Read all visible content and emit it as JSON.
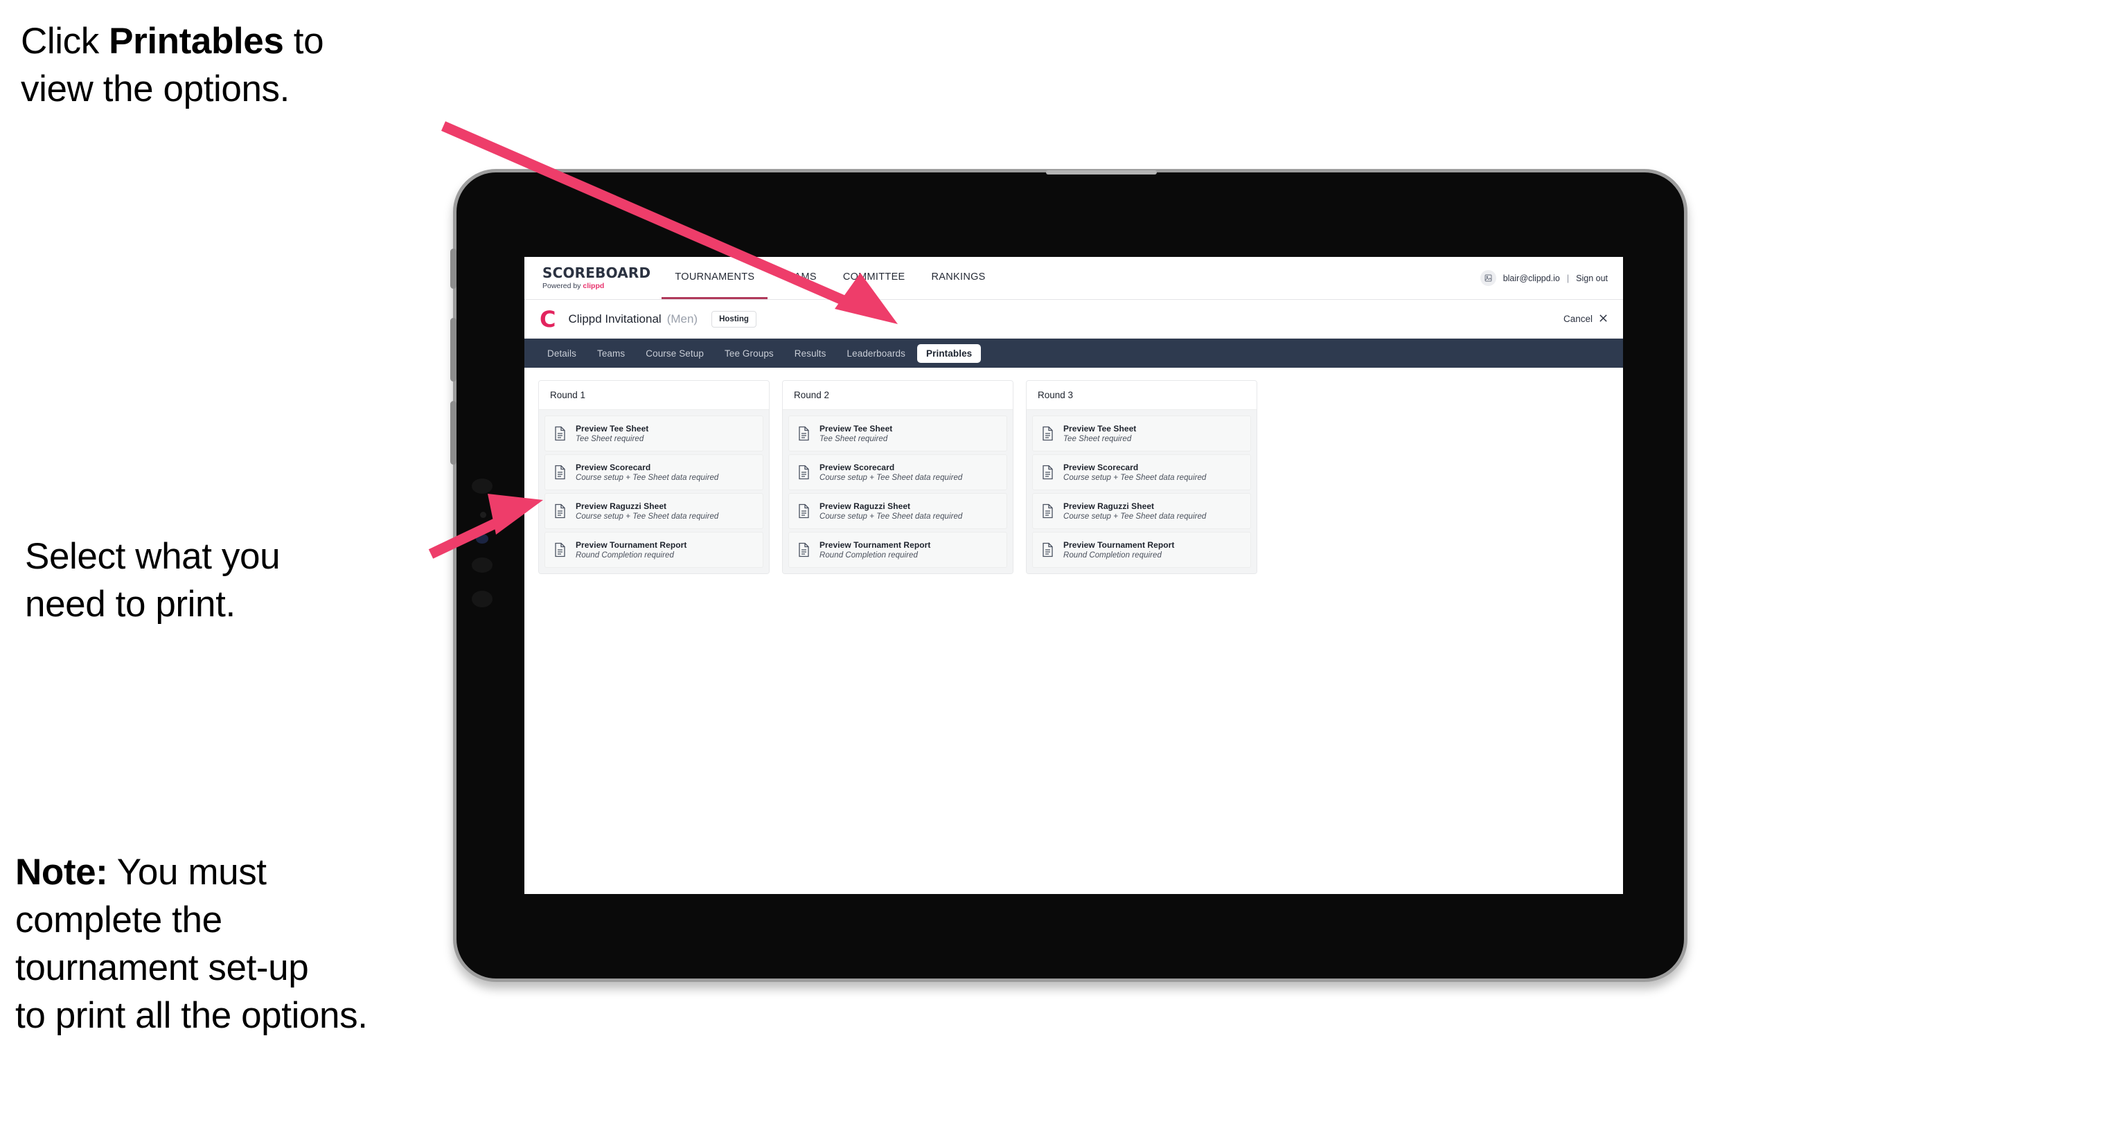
{
  "annotations": {
    "top": {
      "prefix": "Click ",
      "bold": "Printables",
      "suffix": " to\nview the options."
    },
    "middle": {
      "text": "Select what you\n need to print."
    },
    "note": {
      "bold": "Note:",
      "text": " You must\ncomplete the\ntournament set-up\nto print all the options."
    }
  },
  "colors": {
    "arrow_pink": "#ee3d6a",
    "tabbar_dark": "#2e3a4f",
    "clippd_pink": "#e2245e",
    "brand_link_pink": "#e8336d"
  },
  "browser": {
    "header": {
      "brand_title": "SCOREBOARD",
      "brand_sub_prefix": "Powered by ",
      "brand_sub_link": "clippd",
      "nav": [
        {
          "label": "TOURNAMENTS",
          "active": true
        },
        {
          "label": "TEAMS",
          "active": false
        },
        {
          "label": "COMMITTEE",
          "active": false
        },
        {
          "label": "RANKINGS",
          "active": false
        }
      ],
      "avatar_icon": "user-avatar-icon",
      "user_email": "blair@clippd.io",
      "separator": "|",
      "sign_out": "Sign out"
    },
    "tournament_bar": {
      "logo_letter": "C",
      "name": "Clippd Invitational",
      "gender": "(Men)",
      "badge": "Hosting",
      "cancel_label": "Cancel",
      "cancel_icon": "close-x-icon"
    },
    "tabs": [
      {
        "label": "Details",
        "active": false
      },
      {
        "label": "Teams",
        "active": false
      },
      {
        "label": "Course Setup",
        "active": false
      },
      {
        "label": "Tee Groups",
        "active": false
      },
      {
        "label": "Results",
        "active": false
      },
      {
        "label": "Leaderboards",
        "active": false
      },
      {
        "label": "Printables",
        "active": true
      }
    ],
    "rounds": [
      {
        "title": "Round 1",
        "items": [
          {
            "title": "Preview Tee Sheet",
            "sub": "Tee Sheet required"
          },
          {
            "title": "Preview Scorecard",
            "sub": "Course setup + Tee Sheet data required"
          },
          {
            "title": "Preview Raguzzi Sheet",
            "sub": "Course setup + Tee Sheet data required"
          },
          {
            "title": "Preview Tournament Report",
            "sub": "Round Completion required"
          }
        ]
      },
      {
        "title": "Round 2",
        "items": [
          {
            "title": "Preview Tee Sheet",
            "sub": "Tee Sheet required"
          },
          {
            "title": "Preview Scorecard",
            "sub": "Course setup + Tee Sheet data required"
          },
          {
            "title": "Preview Raguzzi Sheet",
            "sub": "Course setup + Tee Sheet data required"
          },
          {
            "title": "Preview Tournament Report",
            "sub": "Round Completion required"
          }
        ]
      },
      {
        "title": "Round 3",
        "items": [
          {
            "title": "Preview Tee Sheet",
            "sub": "Tee Sheet required"
          },
          {
            "title": "Preview Scorecard",
            "sub": "Course setup + Tee Sheet data required"
          },
          {
            "title": "Preview Raguzzi Sheet",
            "sub": "Course setup + Tee Sheet data required"
          },
          {
            "title": "Preview Tournament Report",
            "sub": "Round Completion required"
          }
        ]
      }
    ]
  }
}
